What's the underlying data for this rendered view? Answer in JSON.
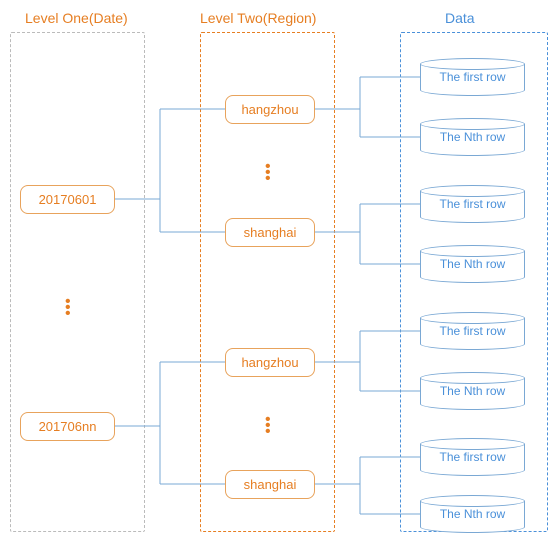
{
  "headers": {
    "level1": "Level One(Date)",
    "level2": "Level Two(Region)",
    "data": "Data"
  },
  "colors": {
    "orange": "#e67e22",
    "blue": "#4a90d9",
    "grey": "#bbb"
  },
  "level1": {
    "item0": "20170601",
    "item1": "201706nn"
  },
  "level2": {
    "group0": {
      "item0": "hangzhou",
      "item1": "shanghai"
    },
    "group1": {
      "item0": "hangzhou",
      "item1": "shanghai"
    }
  },
  "data_rows": {
    "first": "The first row",
    "nth": "The Nth row"
  },
  "ellipsis": "⋮"
}
